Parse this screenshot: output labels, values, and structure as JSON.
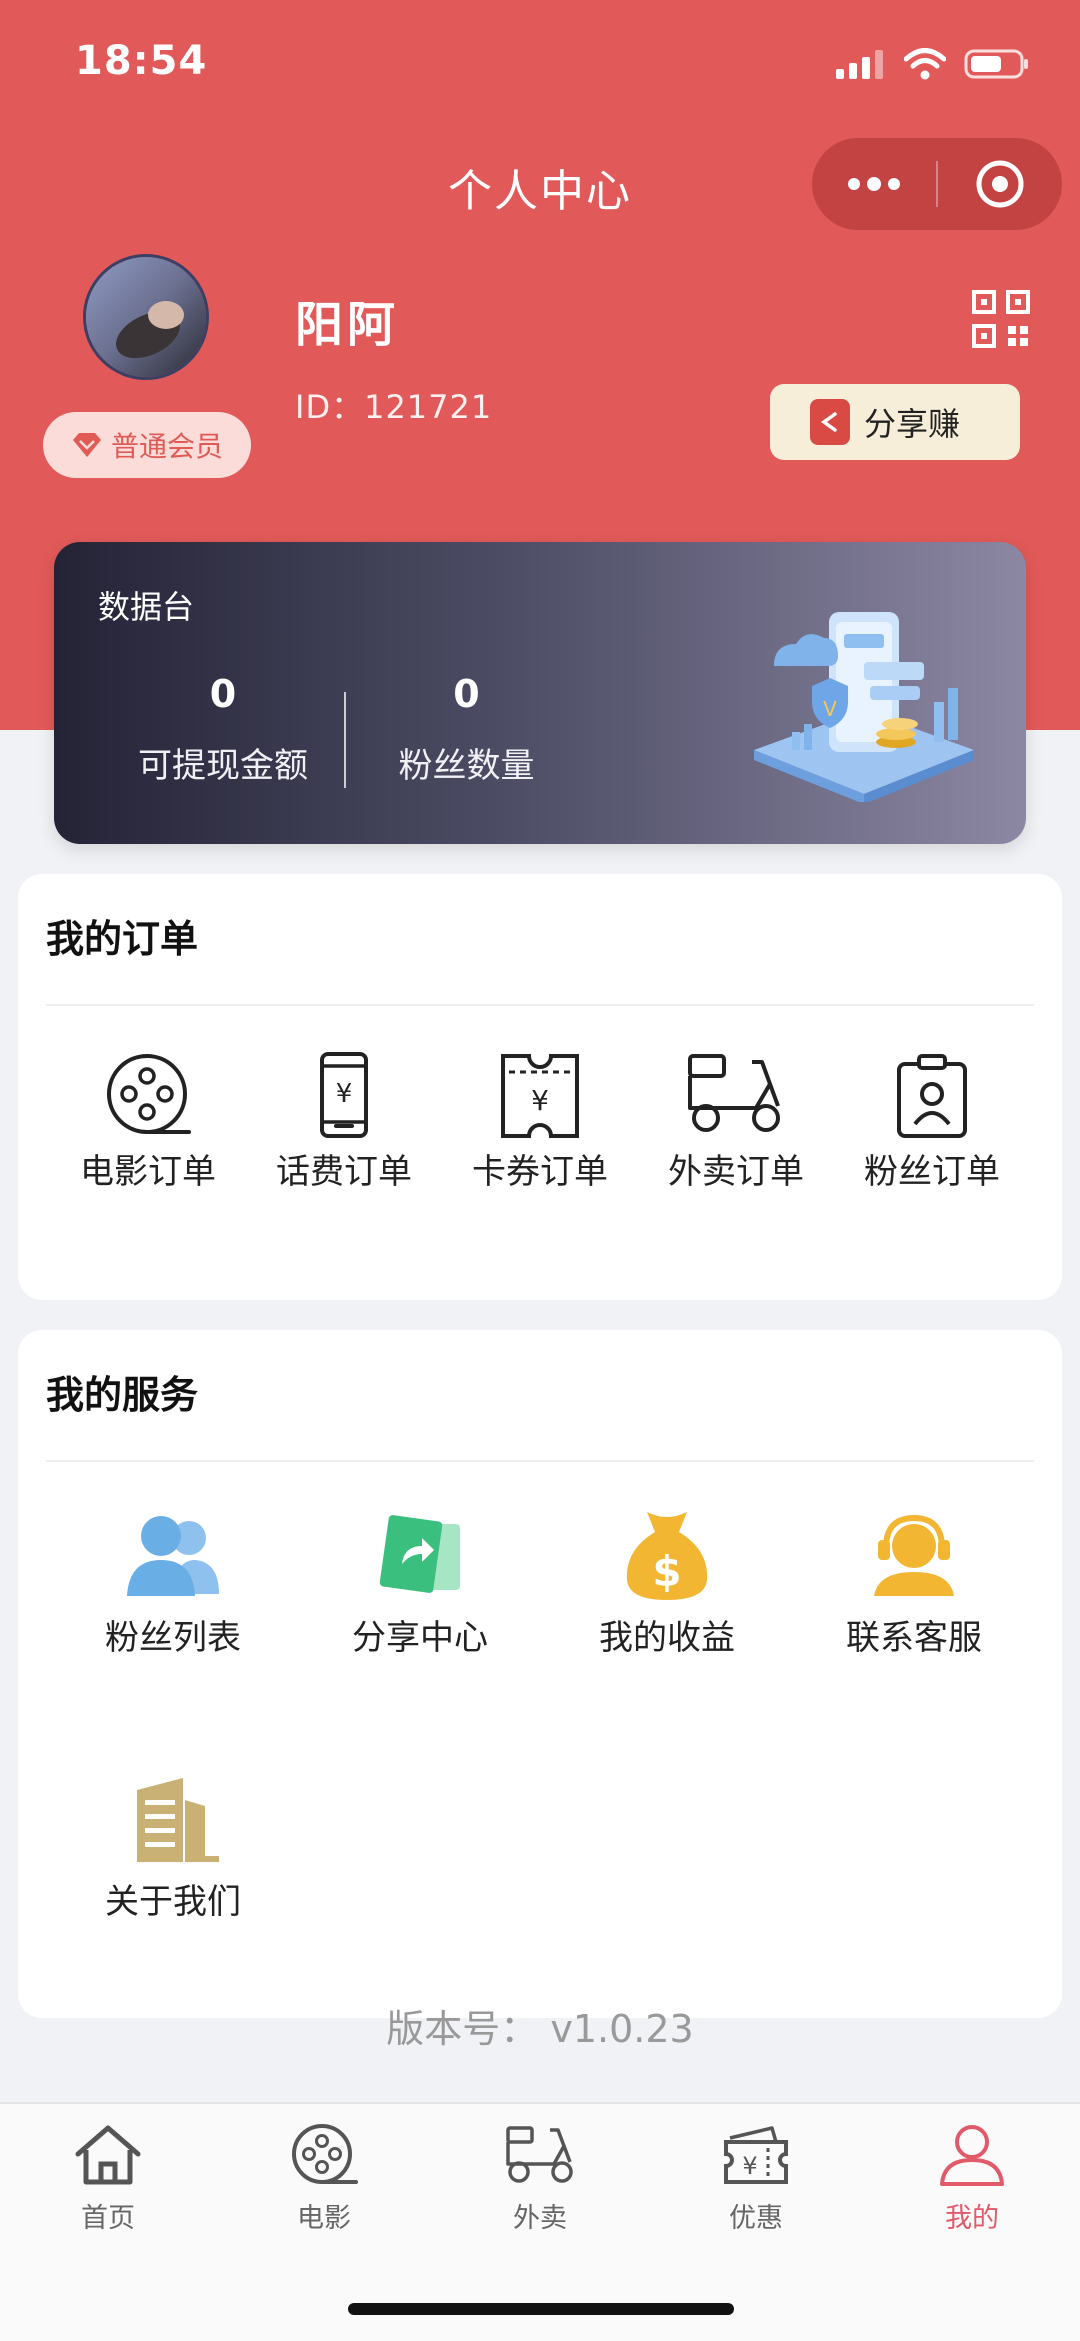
{
  "status_bar": {
    "time": "18:54"
  },
  "nav": {
    "title": "个人中心"
  },
  "profile": {
    "member_level": "普通会员",
    "name": "阳阿",
    "id_text": "ID：121721",
    "share_label": "分享赚"
  },
  "dashboard": {
    "title": "数据台",
    "stats": [
      {
        "value": "0",
        "label": "可提现金额"
      },
      {
        "value": "0",
        "label": "粉丝数量"
      }
    ]
  },
  "orders": {
    "title": "我的订单",
    "items": [
      {
        "label": "电影订单",
        "icon": "film-reel-icon"
      },
      {
        "label": "话费订单",
        "icon": "phone-yuan-icon"
      },
      {
        "label": "卡券订单",
        "icon": "ticket-yuan-icon"
      },
      {
        "label": "外卖订单",
        "icon": "scooter-icon"
      },
      {
        "label": "粉丝订单",
        "icon": "id-badge-icon"
      }
    ]
  },
  "services": {
    "title": "我的服务",
    "items": [
      {
        "label": "粉丝列表",
        "icon": "users-icon"
      },
      {
        "label": "分享中心",
        "icon": "share-card-icon"
      },
      {
        "label": "我的收益",
        "icon": "money-bag-icon"
      },
      {
        "label": "联系客服",
        "icon": "headset-agent-icon"
      },
      {
        "label": "关于我们",
        "icon": "building-icon"
      }
    ]
  },
  "version_text": "版本号：  v1.0.23",
  "tabbar": {
    "tabs": [
      {
        "label": "首页",
        "icon": "home-icon"
      },
      {
        "label": "电影",
        "icon": "film-reel-icon"
      },
      {
        "label": "外卖",
        "icon": "scooter-icon"
      },
      {
        "label": "优惠",
        "icon": "coupon-icon"
      },
      {
        "label": "我的",
        "icon": "user-icon"
      }
    ],
    "active_index": 4
  },
  "colors": {
    "brand_red": "#e15a59",
    "tab_active": "#e15a6a",
    "service_blue": "#6aaee6",
    "service_green": "#3bbf7f",
    "service_gold": "#f2b632",
    "building_gold": "#c9b176"
  }
}
